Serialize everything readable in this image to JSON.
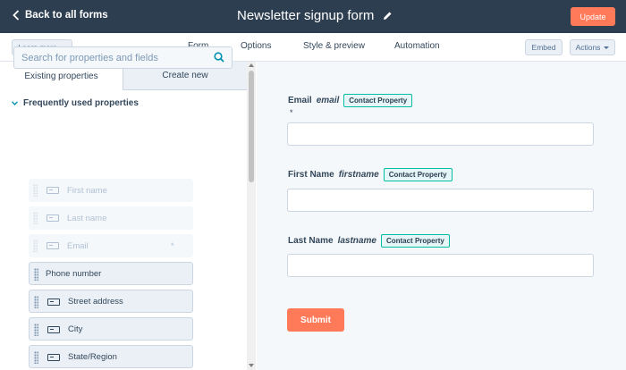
{
  "topbar": {
    "back_label": "Back to all forms",
    "title": "Newsletter signup form",
    "update_label": "Update"
  },
  "subnav": {
    "learn_more": "Learn more",
    "tabs": [
      "Form",
      "Options",
      "Style & preview",
      "Automation"
    ],
    "active_tab": "Form",
    "embed": "Embed",
    "actions": "Actions"
  },
  "sidebar": {
    "tabs": [
      "Existing properties",
      "Create new"
    ],
    "search_placeholder": "Search for properties and fields",
    "section": "Frequently used properties",
    "fields": [
      {
        "label": "First name",
        "state": "disabled",
        "icon": "text-field-icon"
      },
      {
        "label": "Last name",
        "state": "disabled",
        "icon": "text-field-icon"
      },
      {
        "label": "Email",
        "state": "disabled",
        "icon": "text-field-icon",
        "required": "*"
      },
      {
        "label": "Phone number",
        "state": "enabled",
        "icon": ""
      },
      {
        "label": "Street address",
        "state": "enabled",
        "icon": "text-field-icon"
      },
      {
        "label": "City",
        "state": "enabled",
        "icon": "text-field-icon"
      },
      {
        "label": "State/Region",
        "state": "enabled",
        "icon": "text-field-icon"
      }
    ]
  },
  "form": {
    "fields": [
      {
        "label": "Email",
        "internal": "email",
        "badge": "Contact Property",
        "required": "*"
      },
      {
        "label": "First Name",
        "internal": "firstname",
        "badge": "Contact Property"
      },
      {
        "label": "Last Name",
        "internal": "lastname",
        "badge": "Contact Property"
      }
    ],
    "submit_label": "Submit"
  },
  "colors": {
    "topbar_bg": "#2d3e50",
    "accent": "#ff7a59",
    "badge_border": "#00bda5"
  }
}
